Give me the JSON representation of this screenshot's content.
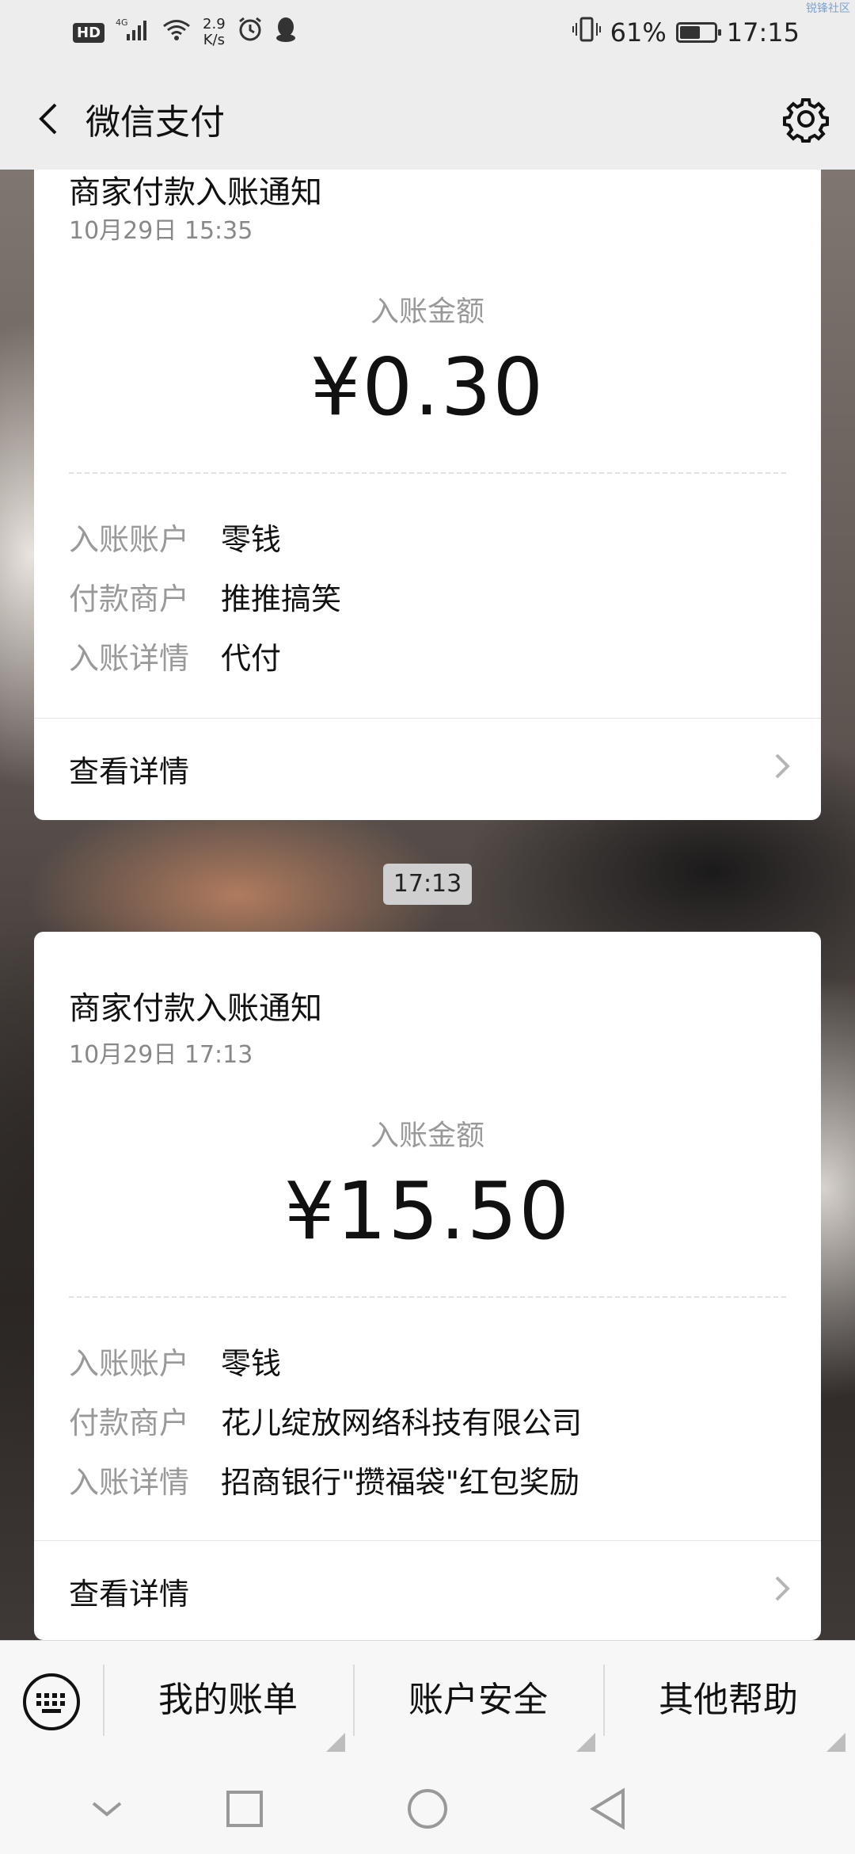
{
  "status_bar": {
    "hd": "HD",
    "network": "4G",
    "speed_value": "2.9",
    "speed_unit": "K/s",
    "battery": "61%",
    "battery_level": 0.61,
    "time": "17:15",
    "icons": [
      "signal-icon",
      "wifi-icon",
      "alarm-icon",
      "qq-icon",
      "vibrate-icon",
      "battery-icon"
    ]
  },
  "watermark": "锐锋社区",
  "nav": {
    "title": "微信支付",
    "back_icon": "back-arrow-icon",
    "settings_icon": "gear-icon"
  },
  "cards": [
    {
      "title": "商家付款入账通知",
      "time": "10月29日  15:35",
      "amount_label": "入账金额",
      "amount": "¥0.30",
      "rows": [
        {
          "key": "入账账户",
          "value": "零钱"
        },
        {
          "key": "付款商户",
          "value": "推推搞笑"
        },
        {
          "key": "入账详情",
          "value": "代付"
        }
      ],
      "detail_link": "查看详情"
    },
    {
      "title": "商家付款入账通知",
      "time": "10月29日  17:13",
      "amount_label": "入账金额",
      "amount": "¥15.50",
      "rows": [
        {
          "key": "入账账户",
          "value": "零钱"
        },
        {
          "key": "付款商户",
          "value": "花儿绽放网络科技有限公司"
        },
        {
          "key": "入账详情",
          "value": "招商银行\"攒福袋\"红包奖励"
        }
      ],
      "detail_link": "查看详情"
    }
  ],
  "time_chip": "17:13",
  "bottom_menu": {
    "keyboard_icon": "keyboard-icon",
    "items": [
      "我的账单",
      "账户安全",
      "其他帮助"
    ]
  },
  "system_nav": [
    "chevron-down-icon",
    "square-icon",
    "circle-icon",
    "triangle-back-icon"
  ],
  "colors": {
    "bar_bg": "#ededed",
    "card_bg": "#ffffff",
    "muted_text": "#999999",
    "primary_text": "#111111"
  }
}
